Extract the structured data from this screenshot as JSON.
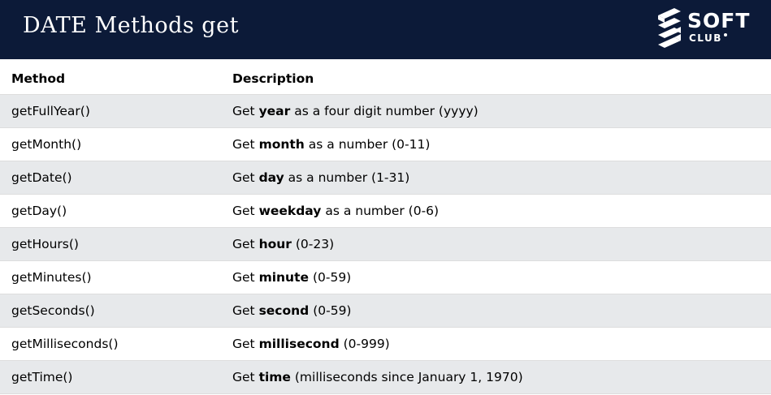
{
  "header": {
    "title": "DATE Methods get",
    "logo_word": "SOFT",
    "logo_sub": "CLUB"
  },
  "table": {
    "columns": [
      "Method",
      "Description"
    ],
    "rows": [
      {
        "method": "getFullYear()",
        "pre": "Get ",
        "bold": "year",
        "post": " as a four digit number (yyyy)"
      },
      {
        "method": "getMonth()",
        "pre": "Get ",
        "bold": "month",
        "post": " as a number (0-11)"
      },
      {
        "method": "getDate()",
        "pre": "Get ",
        "bold": "day",
        "post": " as a number (1-31)"
      },
      {
        "method": "getDay()",
        "pre": "Get ",
        "bold": "weekday",
        "post": " as a number (0-6)"
      },
      {
        "method": "getHours()",
        "pre": "Get ",
        "bold": "hour",
        "post": " (0-23)"
      },
      {
        "method": "getMinutes()",
        "pre": "Get ",
        "bold": "minute",
        "post": " (0-59)"
      },
      {
        "method": "getSeconds()",
        "pre": "Get ",
        "bold": "second",
        "post": " (0-59)"
      },
      {
        "method": "getMilliseconds()",
        "pre": "Get ",
        "bold": "millisecond",
        "post": " (0-999)"
      },
      {
        "method": "getTime()",
        "pre": "Get ",
        "bold": "time",
        "post": " (milliseconds since January 1, 1970)"
      }
    ]
  },
  "colors": {
    "header_bg": "#0c1a38",
    "stripe": "#e7e9eb",
    "border": "#dddddd"
  }
}
